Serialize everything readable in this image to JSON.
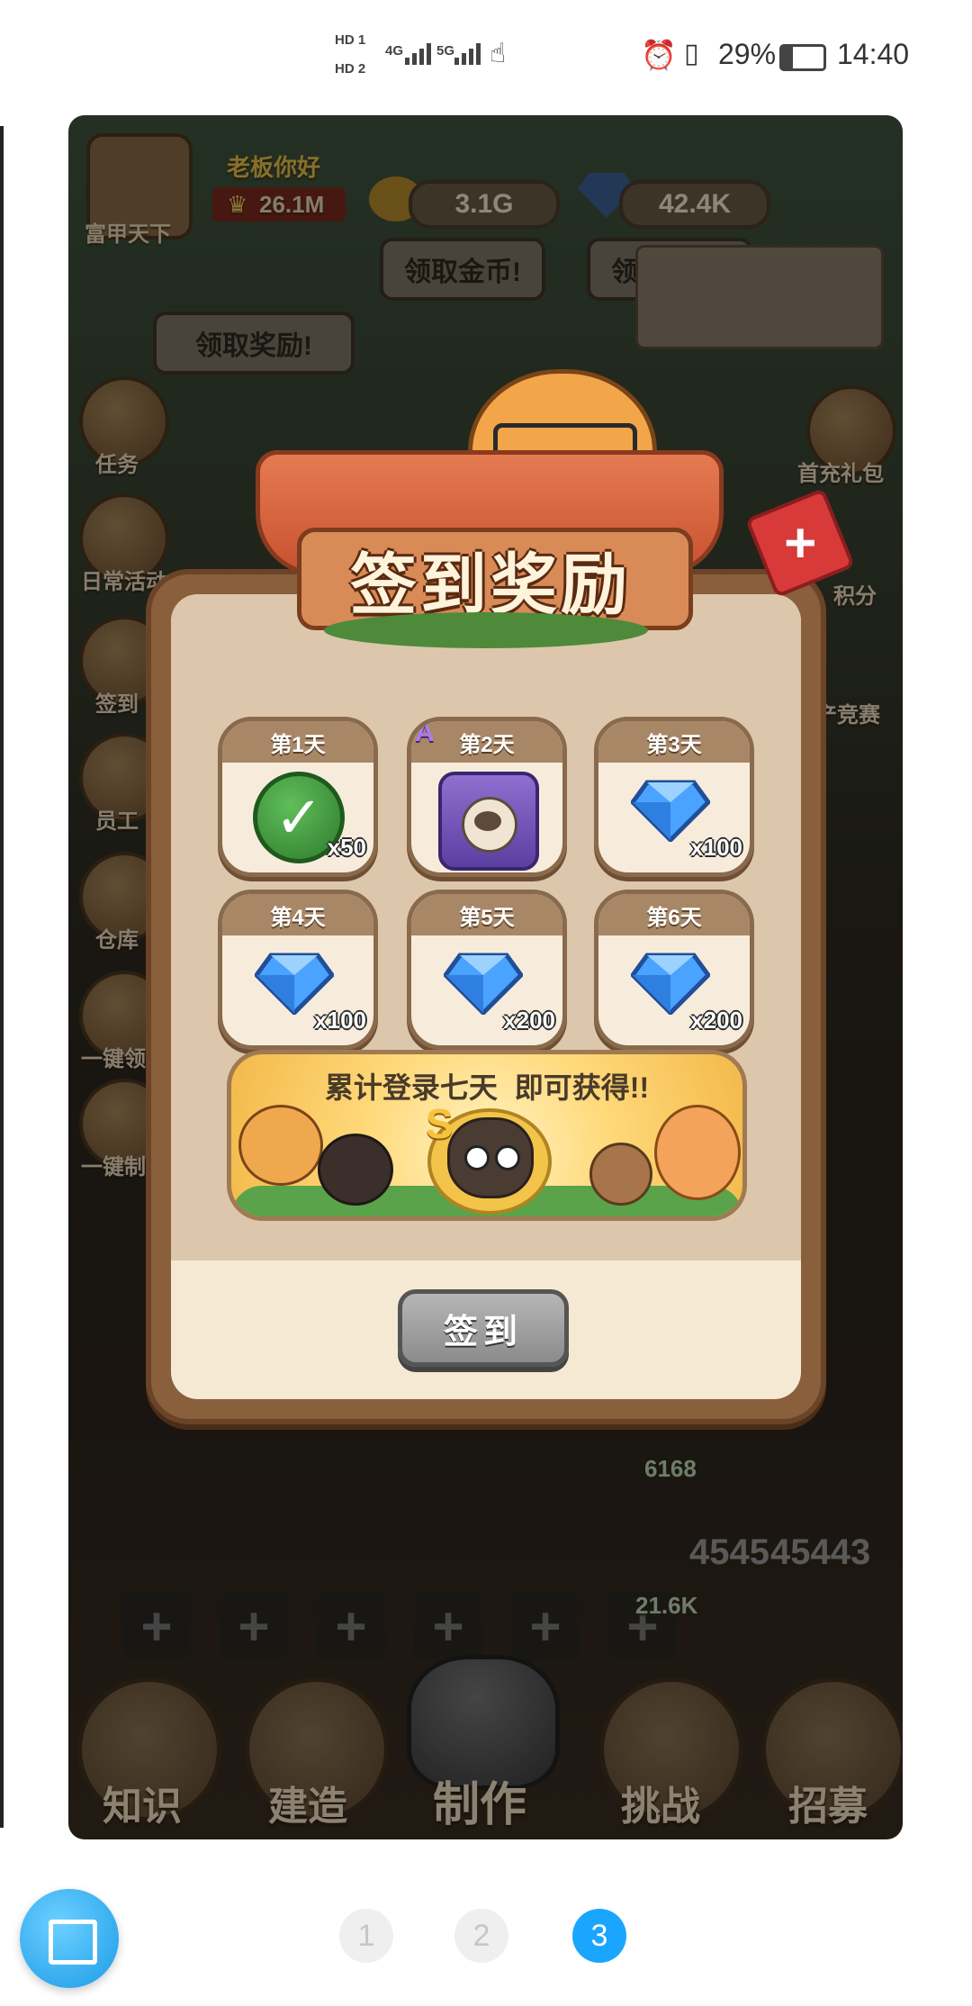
{
  "status_bar": {
    "sim1": "HD 1",
    "sim2": "HD 2",
    "net1": "4G",
    "net2": "5G",
    "battery": "29%",
    "time": "14:40"
  },
  "game": {
    "player_name": "富甲天下",
    "greeting": "老板你好",
    "trophy_value": "26.1M",
    "gold": "3.1G",
    "diamonds": "42.4K",
    "claim_gold": "领取金币!",
    "claim_diamond": "领取钻石!",
    "claim_reward": "领取奖励!",
    "left_menu": [
      "任务",
      "日常活动",
      "签到",
      "员工",
      "仓库",
      "一键领",
      "一键制"
    ],
    "right_menu": [
      "首充礼包",
      "积分",
      "产竞赛"
    ],
    "counters": [
      "6168",
      "21.6K",
      "4545",
      "45443"
    ],
    "bottom_nav": [
      "知识",
      "建造",
      "制作",
      "挑战",
      "招募"
    ]
  },
  "modal": {
    "title": "签到奖励",
    "days": [
      {
        "label": "第1天",
        "qty": "x50",
        "icon": "checkmark-badge-icon",
        "claimed": true
      },
      {
        "label": "第2天",
        "qty": "",
        "icon": "maid-cat-avatar-icon",
        "rank": "A"
      },
      {
        "label": "第3天",
        "qty": "x100",
        "icon": "diamond-icon"
      },
      {
        "label": "第4天",
        "qty": "x100",
        "icon": "diamond-icon"
      },
      {
        "label": "第5天",
        "qty": "x200",
        "icon": "diamond-icon"
      },
      {
        "label": "第6天",
        "qty": "x200",
        "icon": "diamond-icon"
      }
    ],
    "banner_text_a": "累计登录七天",
    "banner_text_b": "即可获得!!",
    "banner_rank": "S",
    "sign_button": "签到",
    "close_symbol": "+"
  },
  "pager": {
    "pages": [
      "1",
      "2",
      "3"
    ],
    "active": "3"
  },
  "colors": {
    "accent": "#1aa6ff",
    "modal_frame": "#8a5f3c",
    "diamond": "#4aa3ff"
  }
}
